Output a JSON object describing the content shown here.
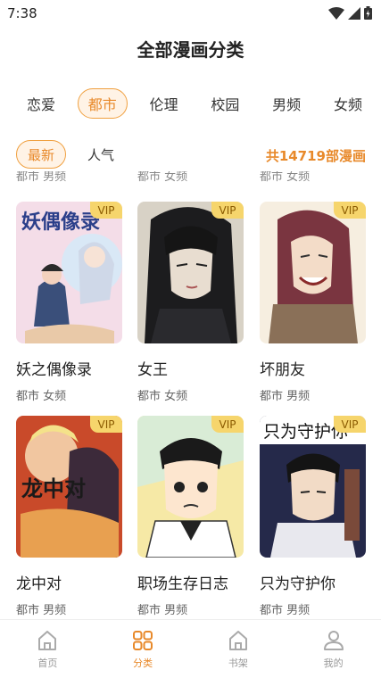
{
  "status_bar": {
    "time": "7:38"
  },
  "page_title": "全部漫画分类",
  "category_tabs": [
    {
      "label": "恋爱",
      "active": false
    },
    {
      "label": "都市",
      "active": true
    },
    {
      "label": "伦理",
      "active": false
    },
    {
      "label": "校园",
      "active": false
    },
    {
      "label": "男频",
      "active": false
    },
    {
      "label": "女频",
      "active": false
    }
  ],
  "sort": {
    "newest": "最新",
    "popular": "人气",
    "count_text": "共14719部漫画"
  },
  "peek_row": [
    "都市 男频",
    "都市 女频",
    "都市 女频"
  ],
  "comics": [
    {
      "title": "妖之偶像录",
      "tags": "都市 女频",
      "vip": "VIP"
    },
    {
      "title": "女王",
      "tags": "都市 女频",
      "vip": "VIP"
    },
    {
      "title": "坏朋友",
      "tags": "都市 男频",
      "vip": "VIP"
    },
    {
      "title": "龙中对",
      "tags": "都市 男频",
      "vip": "VIP"
    },
    {
      "title": "职场生存日志",
      "tags": "都市 男频",
      "vip": "VIP"
    },
    {
      "title": "只为守护你",
      "tags": "都市 男频",
      "vip": "VIP"
    }
  ],
  "cover_texts": {
    "c0": "妖偶像录",
    "c3": "龙中对",
    "c5": "只为守护你"
  },
  "bottom_nav": [
    {
      "label": "首页",
      "icon": "home-icon",
      "active": false
    },
    {
      "label": "分类",
      "icon": "category-grid-icon",
      "active": true
    },
    {
      "label": "书架",
      "icon": "bookshelf-icon",
      "active": false
    },
    {
      "label": "我的",
      "icon": "user-icon",
      "active": false
    }
  ],
  "colors": {
    "accent": "#e8892a",
    "accent_border": "#f0a040",
    "accent_bg": "#fff3e6",
    "vip_bg": "#f6d56c"
  }
}
